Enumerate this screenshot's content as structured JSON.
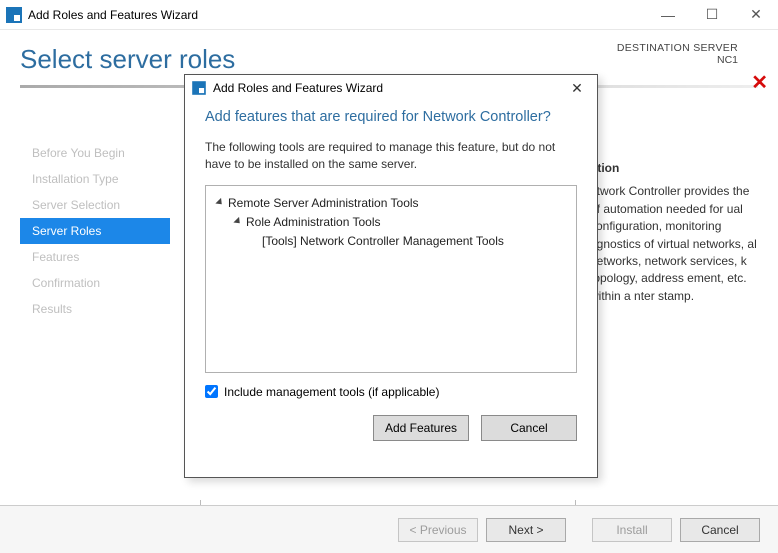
{
  "titlebar": {
    "title": "Add Roles and Features Wizard"
  },
  "page": {
    "heading": "Select server roles",
    "destination_label": "DESTINATION SERVER",
    "destination_value": "NC1"
  },
  "nav": {
    "items": [
      "Before You Begin",
      "Installation Type",
      "Server Selection",
      "Server Roles",
      "Features",
      "Confirmation",
      "Results"
    ],
    "active_index": 3
  },
  "description": {
    "heading_fragment": "ption",
    "body_fragment": "etwork Controller provides the of automation needed for ual configuration, monitoring agnostics of virtual networks, al networks, network services, k topology, address ement, etc. within a nter stamp."
  },
  "footer": {
    "previous": "< Previous",
    "next": "Next >",
    "install": "Install",
    "cancel": "Cancel"
  },
  "modal": {
    "title": "Add Roles and Features Wizard",
    "heading": "Add features that are required for Network Controller?",
    "desc": "The following tools are required to manage this feature, but do not have to be installed on the same server.",
    "tree": {
      "l1": "Remote Server Administration Tools",
      "l2": "Role Administration Tools",
      "l3": "[Tools] Network Controller Management Tools"
    },
    "include_label": "Include management tools (if applicable)",
    "include_checked": true,
    "add_features": "Add Features",
    "cancel": "Cancel"
  }
}
